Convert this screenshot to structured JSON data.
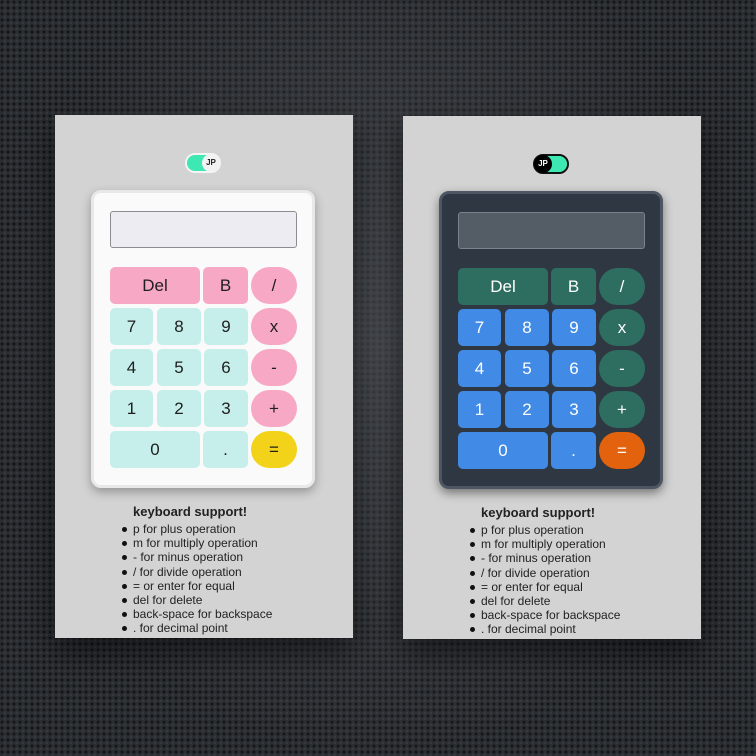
{
  "calculators": [
    {
      "theme": "light",
      "toggle_label": "JP",
      "display_value": "",
      "keys": {
        "del": "Del",
        "backspace": "B",
        "divide": "/",
        "seven": "7",
        "eight": "8",
        "nine": "9",
        "multiply": "x",
        "four": "4",
        "five": "5",
        "six": "6",
        "minus": "-",
        "one": "1",
        "two": "2",
        "three": "3",
        "plus": "+",
        "zero": "0",
        "dot": ".",
        "equals": "="
      },
      "colors": {
        "function_keys": "#f7a8c4",
        "number_keys": "#c6efec",
        "equals_key": "#f3d21a",
        "toggle_track": "#3ee8b3"
      },
      "help": {
        "title": "keyboard support!",
        "items": [
          "p for plus operation",
          "m for multiply operation",
          "- for minus operation",
          "/ for divide operation",
          "= or enter for equal",
          "del for delete",
          "back-space for backspace",
          ". for decimal point"
        ]
      }
    },
    {
      "theme": "dark",
      "toggle_label": "JP",
      "display_value": "",
      "keys": {
        "del": "Del",
        "backspace": "B",
        "divide": "/",
        "seven": "7",
        "eight": "8",
        "nine": "9",
        "multiply": "x",
        "four": "4",
        "five": "5",
        "six": "6",
        "minus": "-",
        "one": "1",
        "two": "2",
        "three": "3",
        "plus": "+",
        "zero": "0",
        "dot": ".",
        "equals": "="
      },
      "colors": {
        "function_keys": "#2e6e60",
        "number_keys": "#418be6",
        "equals_key": "#e3620d",
        "toggle_track": "#3ee8b3"
      },
      "help": {
        "title": "keyboard support!",
        "items": [
          "p for plus operation",
          "m for multiply operation",
          "- for minus operation",
          "/ for divide operation",
          "= or enter for equal",
          "del for delete",
          "back-space for backspace",
          ". for decimal point"
        ]
      }
    }
  ]
}
